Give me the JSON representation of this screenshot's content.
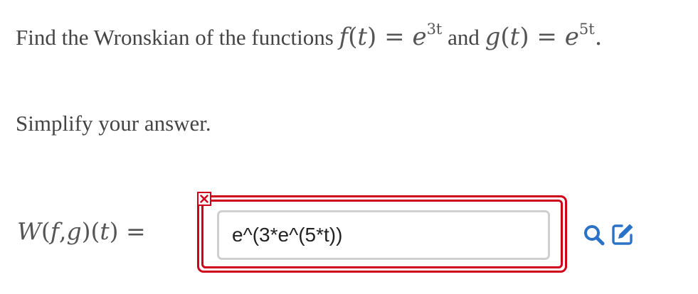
{
  "question": {
    "prefix": "Find the Wronskian of the functions",
    "f_name": "f",
    "t_var": "t",
    "equals": "=",
    "base": "e",
    "f_exponent": "3t",
    "conjunction": "and",
    "g_name": "g",
    "g_exponent": "5t",
    "period": "."
  },
  "instruction": "Simplify your answer.",
  "answer": {
    "label_w": "W",
    "label_f": "f",
    "label_comma": ",",
    "label_g": "g",
    "label_t": "t",
    "label_equals": "=",
    "input_value": "e^(3*e^(5*t))",
    "error_marker": "×"
  },
  "icons": {
    "preview": "magnifier-icon",
    "edit": "pencil-square-icon"
  },
  "colors": {
    "error": "#d0021b",
    "action_icons": "#2a72c7",
    "input_border": "#cfcfcf"
  }
}
